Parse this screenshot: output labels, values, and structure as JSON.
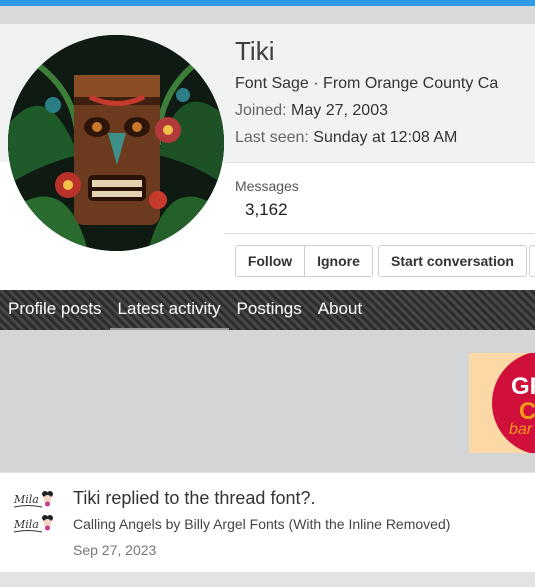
{
  "profile": {
    "name": "Tiki",
    "title_line": "Font Sage · From Orange County Ca",
    "joined_label": "Joined:",
    "joined_value": "May 27, 2003",
    "last_seen_label": "Last seen:",
    "last_seen_value": "Sunday at 12:08 AM",
    "messages_label": "Messages",
    "messages_value": "3,162",
    "buttons": {
      "follow": "Follow",
      "ignore": "Ignore",
      "start_conversation": "Start conversation"
    }
  },
  "tabs": [
    {
      "label": "Profile posts",
      "active": false
    },
    {
      "label": "Latest activity",
      "active": true
    },
    {
      "label": "Postings",
      "active": false
    },
    {
      "label": "About",
      "active": false
    }
  ],
  "ad": {
    "text_line1": "GR",
    "text_line2": "C",
    "text_line3": "bar"
  },
  "feed": [
    {
      "title": "Tiki replied to the thread font?.",
      "snippet": "Calling Angels by Billy Argel Fonts (With the Inline Removed)",
      "date": "Sep 27, 2023",
      "avatar_text": "Mila"
    }
  ],
  "colors": {
    "accent": "#2f9be6",
    "tabbar": "#3a3a3a",
    "ad_red": "#d0103a",
    "ad_orange": "#f59a1b"
  }
}
